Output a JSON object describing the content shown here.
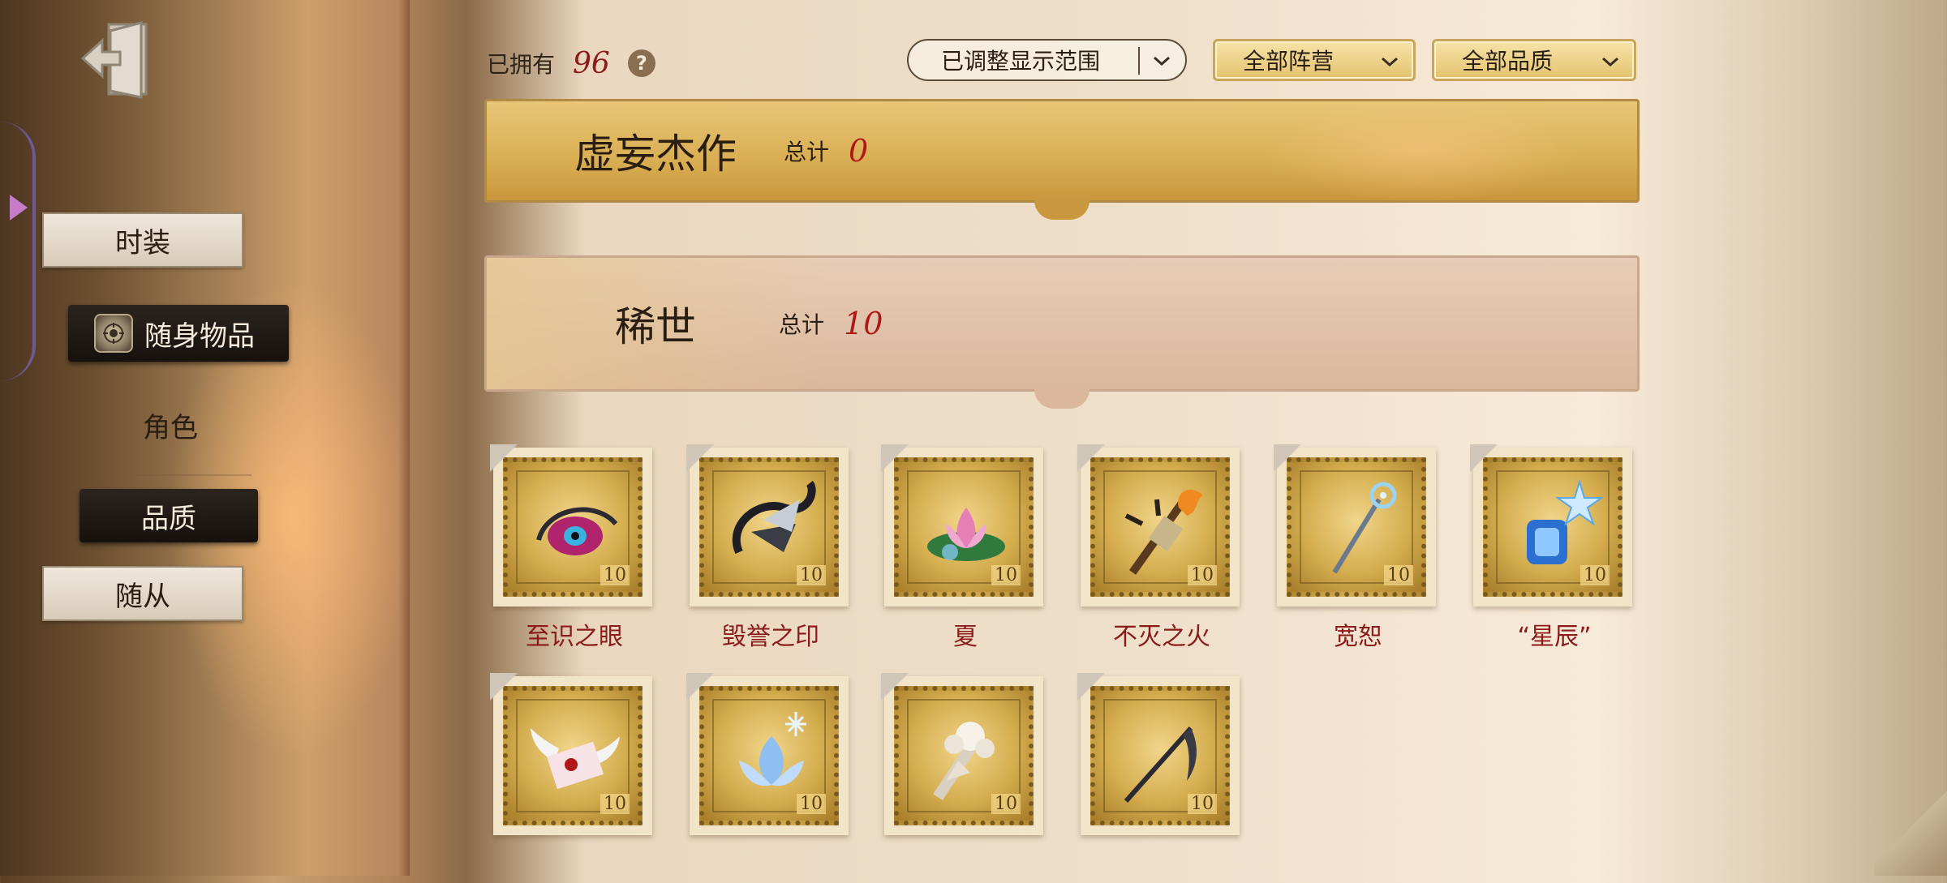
{
  "nav": {
    "exit_icon": "exit-door-icon",
    "items": [
      {
        "label": "时装",
        "state": "paper"
      },
      {
        "label": "随身物品",
        "state": "active",
        "icon": "shield-emblem-icon"
      },
      {
        "label": "角色",
        "state": "plain"
      },
      {
        "label": "品质",
        "state": "dark"
      },
      {
        "label": "随从",
        "state": "paper"
      }
    ]
  },
  "header": {
    "owned_label": "已拥有",
    "owned_count": "96",
    "help_icon": "?",
    "filters": {
      "range": "已调整显示范围",
      "faction": "全部阵营",
      "quality": "全部品质"
    }
  },
  "sections": [
    {
      "title": "虚妄杰作",
      "total_label": "总计",
      "count": "0"
    },
    {
      "title": "稀世",
      "total_label": "总计",
      "count": "10"
    }
  ],
  "items": [
    {
      "name": "至识之眼",
      "icon": "eye-amulet-icon",
      "value": "10"
    },
    {
      "name": "毁誉之印",
      "icon": "dark-wing-seal-icon",
      "value": "10"
    },
    {
      "name": "夏",
      "icon": "lotus-flower-icon",
      "value": "10"
    },
    {
      "name": "不灭之火",
      "icon": "flame-torch-icon",
      "value": "10"
    },
    {
      "name": "宽恕",
      "icon": "crystal-staff-icon",
      "value": "10"
    },
    {
      "name": "“星辰”",
      "icon": "star-lantern-icon",
      "value": "10"
    },
    {
      "name": "",
      "icon": "winged-letter-icon",
      "value": "10"
    },
    {
      "name": "",
      "icon": "ice-lotus-icon",
      "value": "10"
    },
    {
      "name": "",
      "icon": "white-rose-bouquet-icon",
      "value": "10"
    },
    {
      "name": "",
      "icon": "scythe-icon",
      "value": "10"
    }
  ],
  "colors": {
    "accent_red": "#8b1a1a",
    "gold": "#d9ae52",
    "dark_button": "#1f1914"
  }
}
